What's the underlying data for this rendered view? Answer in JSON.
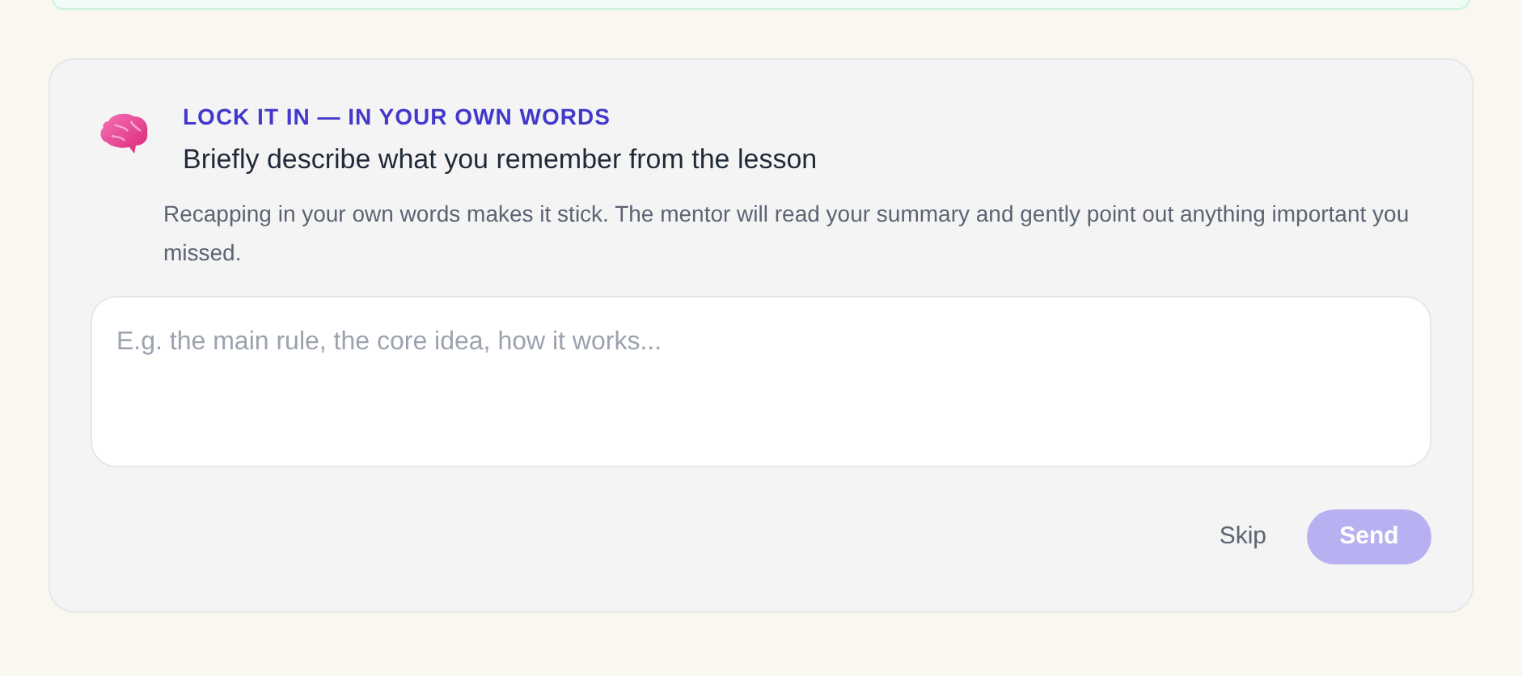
{
  "prompt_card": {
    "eyebrow": "LOCK IT IN — IN YOUR OWN WORDS",
    "heading": "Briefly describe what you remember from the lesson",
    "description": "Recapping in your own words makes it stick. The mentor will read your summary and gently point out anything important you missed.",
    "answer": {
      "placeholder": "E.g. the main rule, the core idea, how it works..."
    },
    "buttons": [
      {
        "label": "Skip",
        "kind": "link",
        "disabled": false
      },
      {
        "label": "Send",
        "kind": "primary",
        "disabled": true
      }
    ]
  }
}
